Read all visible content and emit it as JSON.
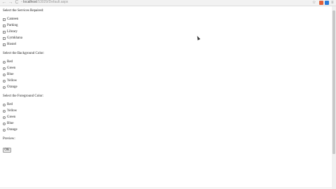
{
  "browser": {
    "back": "←",
    "forward": "→",
    "reload": "C",
    "url_host": "localhost",
    "url_path": ":53029/Default.aspx",
    "star": "☆",
    "menu": "≡",
    "colors": {
      "ext1": "#e0603a",
      "ext2": "#2a7bd8"
    }
  },
  "form": {
    "services_label": "Select the Services Repaired:",
    "services": [
      "Canteen",
      "Parking",
      "Library",
      "Gymkhana",
      "Hostel"
    ],
    "background_label": "Select the Background Color:",
    "background_colors": [
      "Red",
      "Green",
      "Blue",
      "Yellow",
      "Orange"
    ],
    "foreground_label": "Select the Foreground Color:",
    "foreground_colors": [
      "Red",
      "Yellow",
      "Green",
      "Blue",
      "Orange"
    ],
    "preview_label": "Preview:",
    "ok_label": "OK"
  }
}
